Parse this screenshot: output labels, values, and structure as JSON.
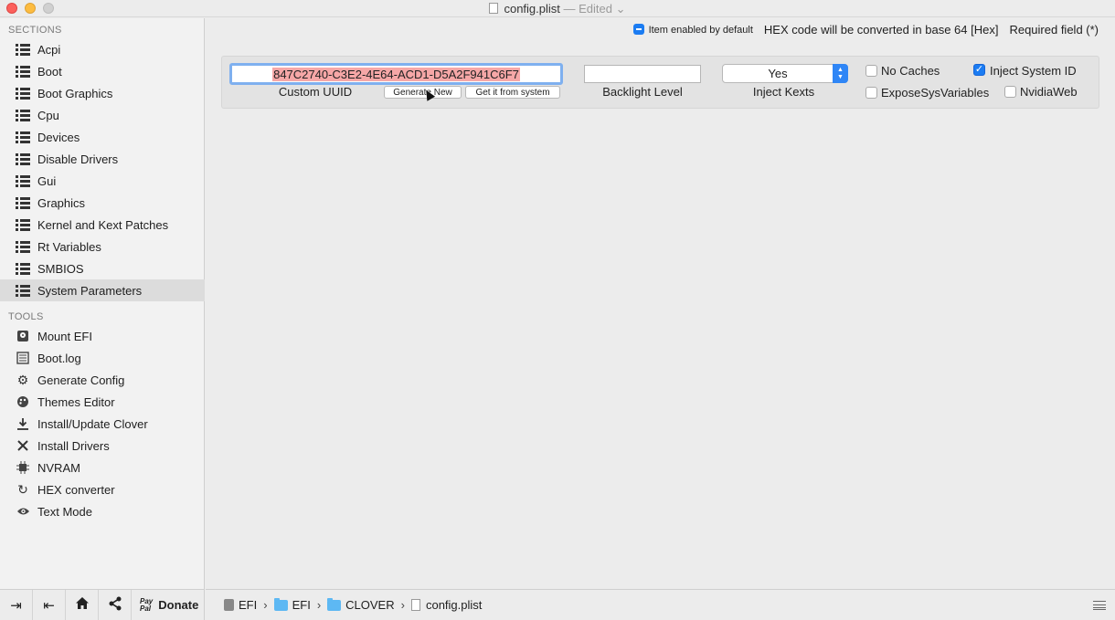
{
  "window": {
    "title": "config.plist",
    "edited": "— Edited"
  },
  "sidebar": {
    "sections_header": "SECTIONS",
    "sections": [
      {
        "label": "Acpi"
      },
      {
        "label": "Boot"
      },
      {
        "label": "Boot Graphics"
      },
      {
        "label": "Cpu"
      },
      {
        "label": "Devices"
      },
      {
        "label": "Disable Drivers"
      },
      {
        "label": "Gui"
      },
      {
        "label": "Graphics"
      },
      {
        "label": "Kernel and Kext Patches"
      },
      {
        "label": "Rt Variables"
      },
      {
        "label": "SMBIOS"
      },
      {
        "label": "System Parameters",
        "selected": true
      }
    ],
    "tools_header": "TOOLS",
    "tools": [
      {
        "label": "Mount EFI",
        "icon": "disk-icon"
      },
      {
        "label": "Boot.log",
        "icon": "log-icon"
      },
      {
        "label": "Generate Config",
        "icon": "gears-icon"
      },
      {
        "label": "Themes Editor",
        "icon": "palette-icon"
      },
      {
        "label": "Install/Update Clover",
        "icon": "download-icon"
      },
      {
        "label": "Install Drivers",
        "icon": "wrench-icon"
      },
      {
        "label": "NVRAM",
        "icon": "chip-icon"
      },
      {
        "label": "HEX converter",
        "icon": "refresh-icon"
      },
      {
        "label": "Text Mode",
        "icon": "eye-icon"
      }
    ],
    "bottom": {
      "paypal_line1": "Pay",
      "paypal_line2": "Pal",
      "donate_label": "Donate"
    }
  },
  "main": {
    "legend_enabled": "Item enabled by default",
    "legend_hex": "HEX code will be converted in base 64 [Hex]",
    "legend_required": "Required field (*)",
    "custom_uuid": {
      "value": "847C2740-C3E2-4E64-ACD1-D5A2F941C6F7",
      "label": "Custom UUID",
      "generate_button": "Generate New",
      "from_system_button": "Get it from system"
    },
    "backlight": {
      "value": "",
      "label": "Backlight Level"
    },
    "inject_kexts": {
      "value": "Yes",
      "label": "Inject Kexts"
    },
    "checkboxes": {
      "no_caches": {
        "label": "No Caches",
        "checked": false
      },
      "inject_system_id": {
        "label": "Inject System ID",
        "checked": true
      },
      "expose_sys_variables": {
        "label": "ExposeSysVariables",
        "checked": false
      },
      "nvidia_web": {
        "label": "NvidiaWeb",
        "checked": false
      }
    }
  },
  "pathbar": {
    "crumbs": [
      "EFI",
      "EFI",
      "CLOVER",
      "config.plist"
    ],
    "separator": "›"
  }
}
